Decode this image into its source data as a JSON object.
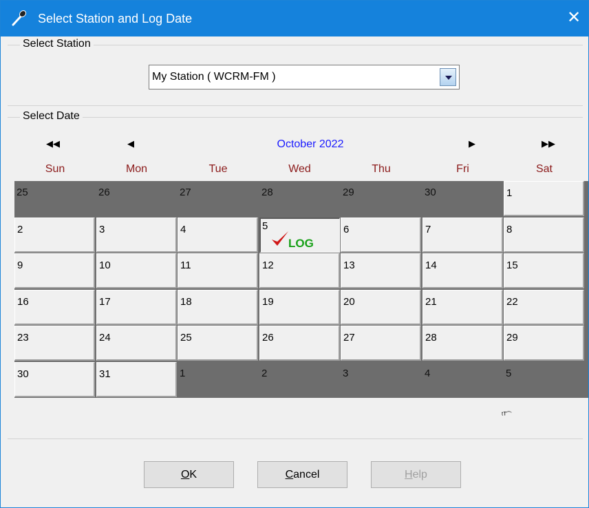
{
  "window": {
    "title": "Select Station and Log Date",
    "close_glyph": "✕",
    "title_icon": "microphone-icon"
  },
  "station_group": {
    "label": "Select Station",
    "combo_value": "My Station ( WCRM-FM )"
  },
  "date_group": {
    "label": "Select Date",
    "nav": {
      "prev_year": "◀◀",
      "prev_month": "◀",
      "next_month": "▶",
      "next_year": "▶▶"
    },
    "month_label": "October 2022",
    "weekdays": [
      "Sun",
      "Mon",
      "Tue",
      "Wed",
      "Thu",
      "Fri",
      "Sat"
    ],
    "weeks": [
      [
        {
          "d": "25",
          "o": true
        },
        {
          "d": "26",
          "o": true
        },
        {
          "d": "27",
          "o": true
        },
        {
          "d": "28",
          "o": true
        },
        {
          "d": "29",
          "o": true
        },
        {
          "d": "30",
          "o": true
        },
        {
          "d": "1",
          "o": false
        }
      ],
      [
        {
          "d": "2",
          "o": false
        },
        {
          "d": "3",
          "o": false
        },
        {
          "d": "4",
          "o": false
        },
        {
          "d": "5",
          "o": false,
          "log": true
        },
        {
          "d": "6",
          "o": false
        },
        {
          "d": "7",
          "o": false
        },
        {
          "d": "8",
          "o": false
        }
      ],
      [
        {
          "d": "9",
          "o": false
        },
        {
          "d": "10",
          "o": false
        },
        {
          "d": "11",
          "o": false
        },
        {
          "d": "12",
          "o": false
        },
        {
          "d": "13",
          "o": false
        },
        {
          "d": "14",
          "o": false
        },
        {
          "d": "15",
          "o": false
        }
      ],
      [
        {
          "d": "16",
          "o": false
        },
        {
          "d": "17",
          "o": false
        },
        {
          "d": "18",
          "o": false
        },
        {
          "d": "19",
          "o": false
        },
        {
          "d": "20",
          "o": false
        },
        {
          "d": "21",
          "o": false
        },
        {
          "d": "22",
          "o": false
        }
      ],
      [
        {
          "d": "23",
          "o": false
        },
        {
          "d": "24",
          "o": false
        },
        {
          "d": "25",
          "o": false
        },
        {
          "d": "26",
          "o": false
        },
        {
          "d": "27",
          "o": false
        },
        {
          "d": "28",
          "o": false
        },
        {
          "d": "29",
          "o": false
        }
      ],
      [
        {
          "d": "30",
          "o": false
        },
        {
          "d": "31",
          "o": false
        },
        {
          "d": "1",
          "o": true
        },
        {
          "d": "2",
          "o": true
        },
        {
          "d": "3",
          "o": true
        },
        {
          "d": "4",
          "o": true
        },
        {
          "d": "5",
          "o": true
        }
      ]
    ],
    "log_label": "LOG",
    "check_color": "#d01818",
    "log_color": "#18a018",
    "small_mark": "ᵗᵀ͡"
  },
  "buttons": {
    "ok_mnemonic": "O",
    "ok_rest": "K",
    "cancel_mnemonic": "C",
    "cancel_rest": "ancel",
    "help_mnemonic": "H",
    "help_rest": "elp"
  }
}
